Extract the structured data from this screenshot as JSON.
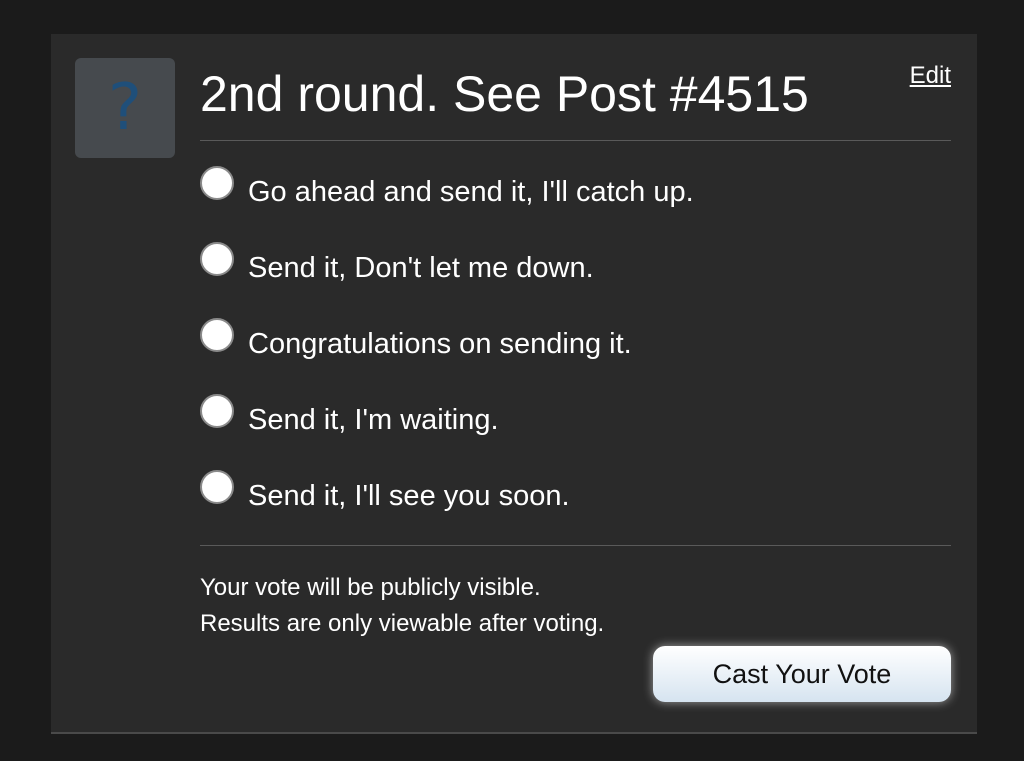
{
  "poll": {
    "avatar_icon": "question-mark-icon",
    "avatar_glyph": "?",
    "title": "2nd round. See Post #4515",
    "edit_label": "Edit",
    "options": [
      {
        "label": "Go ahead and send it, I'll catch up.",
        "selected": false
      },
      {
        "label": "Send it, Don't let me down.",
        "selected": false
      },
      {
        "label": "Congratulations on sending it.",
        "selected": false
      },
      {
        "label": "Send it, I'm waiting.",
        "selected": false
      },
      {
        "label": "Send it, I'll see you soon.",
        "selected": false
      }
    ],
    "notes": {
      "visibility": "Your vote will be publicly visible.",
      "results": "Results are only viewable after voting."
    },
    "vote_button_label": "Cast Your Vote"
  },
  "colors": {
    "page_background": "#1b1b1b",
    "card_background": "#2a2a2a",
    "avatar_background": "#464a4e",
    "avatar_glyph": "#1f4f7a",
    "text": "#ffffff"
  }
}
